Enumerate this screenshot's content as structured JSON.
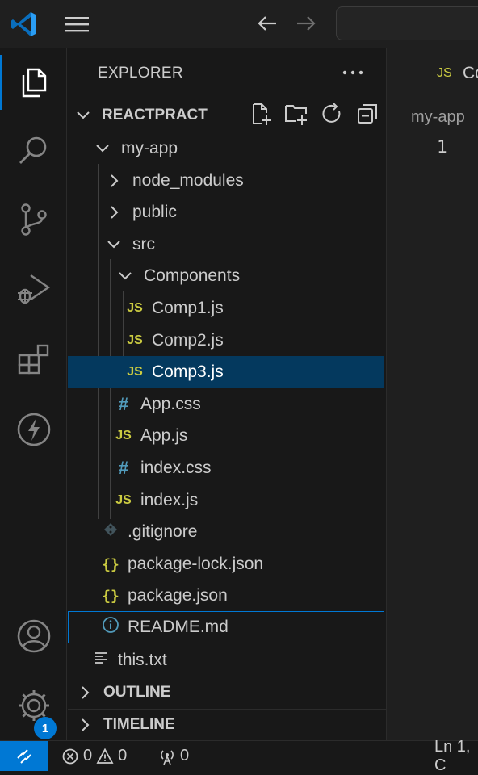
{
  "titlebar": {
    "logo_icon": "vscode-logo-icon",
    "menu_icon": "hamburger-menu-icon",
    "back_icon": "arrow-left-icon",
    "forward_icon": "arrow-right-icon"
  },
  "activity_bar": {
    "items": [
      "explorer",
      "search",
      "source-control",
      "run-and-debug",
      "extensions",
      "thunder-client",
      "accounts",
      "manage"
    ],
    "manage_badge": "1"
  },
  "explorer": {
    "title": "EXPLORER",
    "project": "REACTPRACT",
    "tree": [
      {
        "label": "my-app",
        "type": "folder",
        "open": true
      },
      {
        "label": "node_modules",
        "type": "folder"
      },
      {
        "label": "public",
        "type": "folder"
      },
      {
        "label": "src",
        "type": "folder",
        "open": true
      },
      {
        "label": "Components",
        "type": "folder",
        "open": true
      },
      {
        "label": "Comp1.js",
        "type": "js"
      },
      {
        "label": "Comp2.js",
        "type": "js"
      },
      {
        "label": "Comp3.js",
        "type": "js",
        "selected": true
      },
      {
        "label": "App.css",
        "type": "css"
      },
      {
        "label": "App.js",
        "type": "js"
      },
      {
        "label": "index.css",
        "type": "css"
      },
      {
        "label": "index.js",
        "type": "js"
      },
      {
        "label": ".gitignore",
        "type": "git"
      },
      {
        "label": "package-lock.json",
        "type": "json"
      },
      {
        "label": "package.json",
        "type": "json"
      },
      {
        "label": "README.md",
        "type": "info"
      },
      {
        "label": "this.txt",
        "type": "txt"
      }
    ],
    "outline": "OUTLINE",
    "timeline": "TIMELINE"
  },
  "editor": {
    "tab_icon": "JS",
    "tab_label": "Co",
    "breadcrumb": "my-app",
    "line_number": "1"
  },
  "statusbar": {
    "errors": "0",
    "warnings": "0",
    "ports": "0",
    "position": "Ln 1, C"
  },
  "icons": {
    "js": "JS",
    "css": "#",
    "json": "{}"
  },
  "colors": {
    "accent": "#0078d4",
    "selection": "#04395e",
    "js": "#cbcb41",
    "css": "#519aba"
  }
}
